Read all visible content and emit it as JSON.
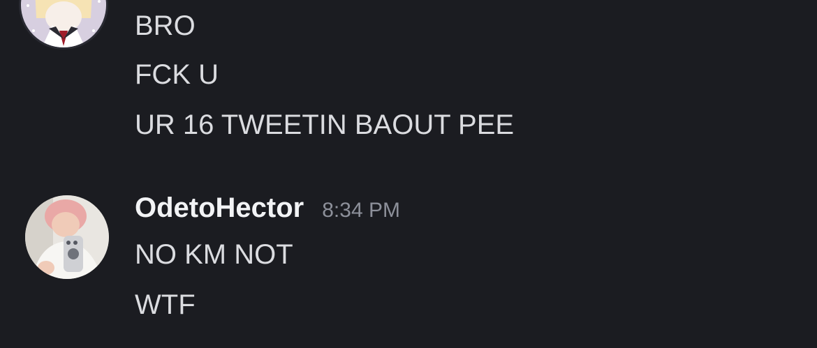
{
  "previous_group": {
    "messages": [
      {
        "text": "BRO"
      },
      {
        "text": "FCK U"
      },
      {
        "text": "UR 16 TWEETIN BAOUT PEE"
      }
    ]
  },
  "current_group": {
    "username": "OdetoHector",
    "timestamp": "8:34 PM",
    "messages": [
      {
        "text": "NO KM NOT"
      },
      {
        "text": "WTF"
      }
    ]
  },
  "colors": {
    "background": "#1b1c21",
    "message_text": "#dbdce0",
    "username": "#f2f3f5",
    "timestamp": "#8d909a"
  }
}
